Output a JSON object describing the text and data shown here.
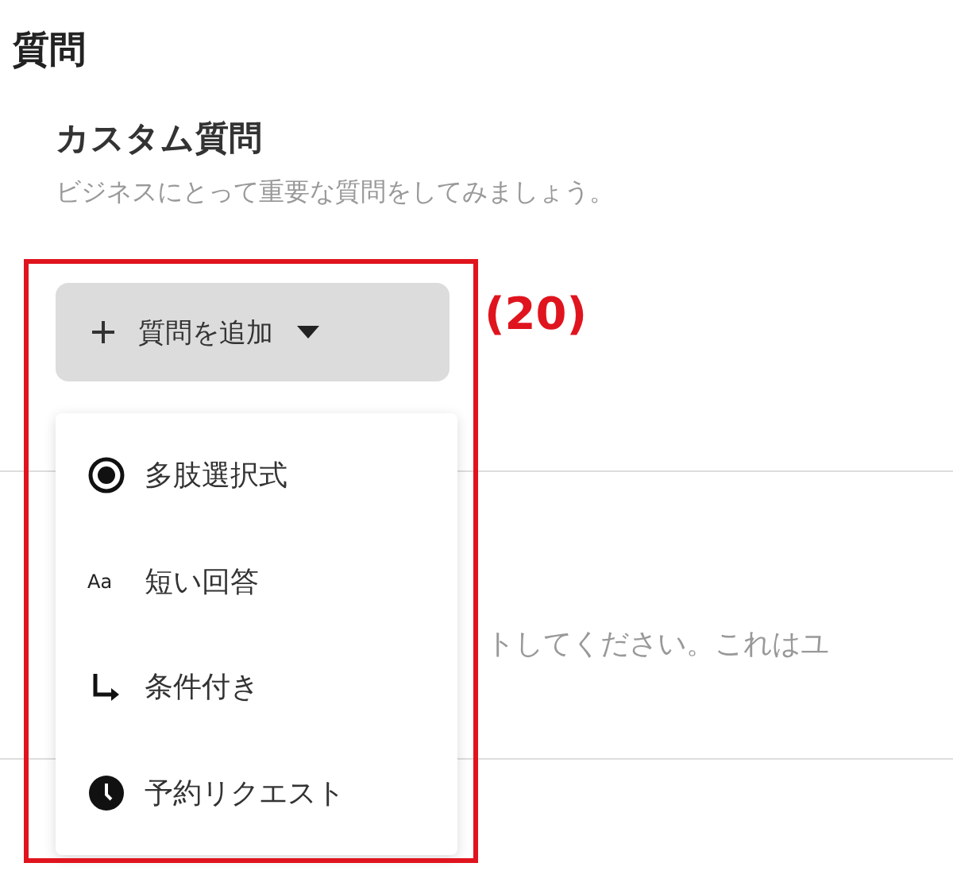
{
  "section_title": "質問",
  "custom": {
    "title": "カスタム質問",
    "description": "ビジネスにとって重要な質問をしてみましょう。"
  },
  "annotation": {
    "label": "(20)",
    "color": "#e0141e"
  },
  "add_button": {
    "label": "質問を追加",
    "expanded": true
  },
  "menu_items": [
    {
      "kind": "radio",
      "label": "多肢選択式"
    },
    {
      "kind": "text",
      "icon_text": "Aa",
      "label": "短い回答"
    },
    {
      "kind": "branch",
      "label": "条件付き"
    },
    {
      "kind": "clock",
      "label": "予約リクエスト"
    }
  ],
  "background_text": "トしてください。これはユ"
}
